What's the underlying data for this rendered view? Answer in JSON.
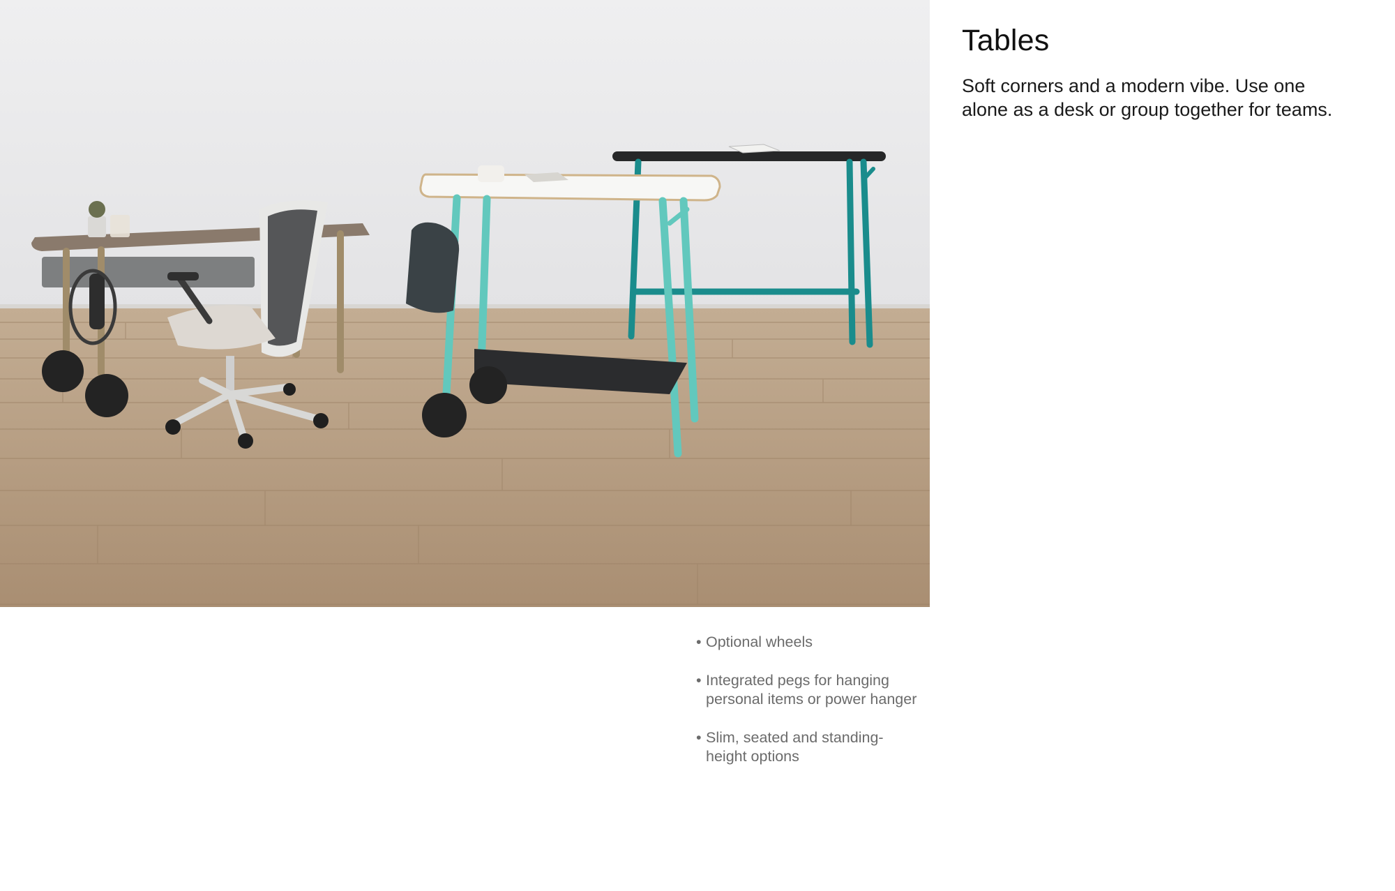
{
  "heading": "Tables",
  "intro": "Soft corners and a modern vibe. Use one alone as a desk or group together for teams.",
  "features": [
    "Optional wheels",
    "Integrated pegs for hanging personal items or power hanger",
    "Slim, seated and standing-height options"
  ],
  "bullet_char": "•",
  "colors": {
    "wall": "#ebebed",
    "floor": "#b49a7c",
    "walnut_top": "#8a7a6c",
    "white_top": "#f7f7f5",
    "black_top": "#262728",
    "mint_legs": "#62c8bd",
    "teal_legs": "#1a8c8c",
    "brass_legs": "#a08c6a"
  }
}
